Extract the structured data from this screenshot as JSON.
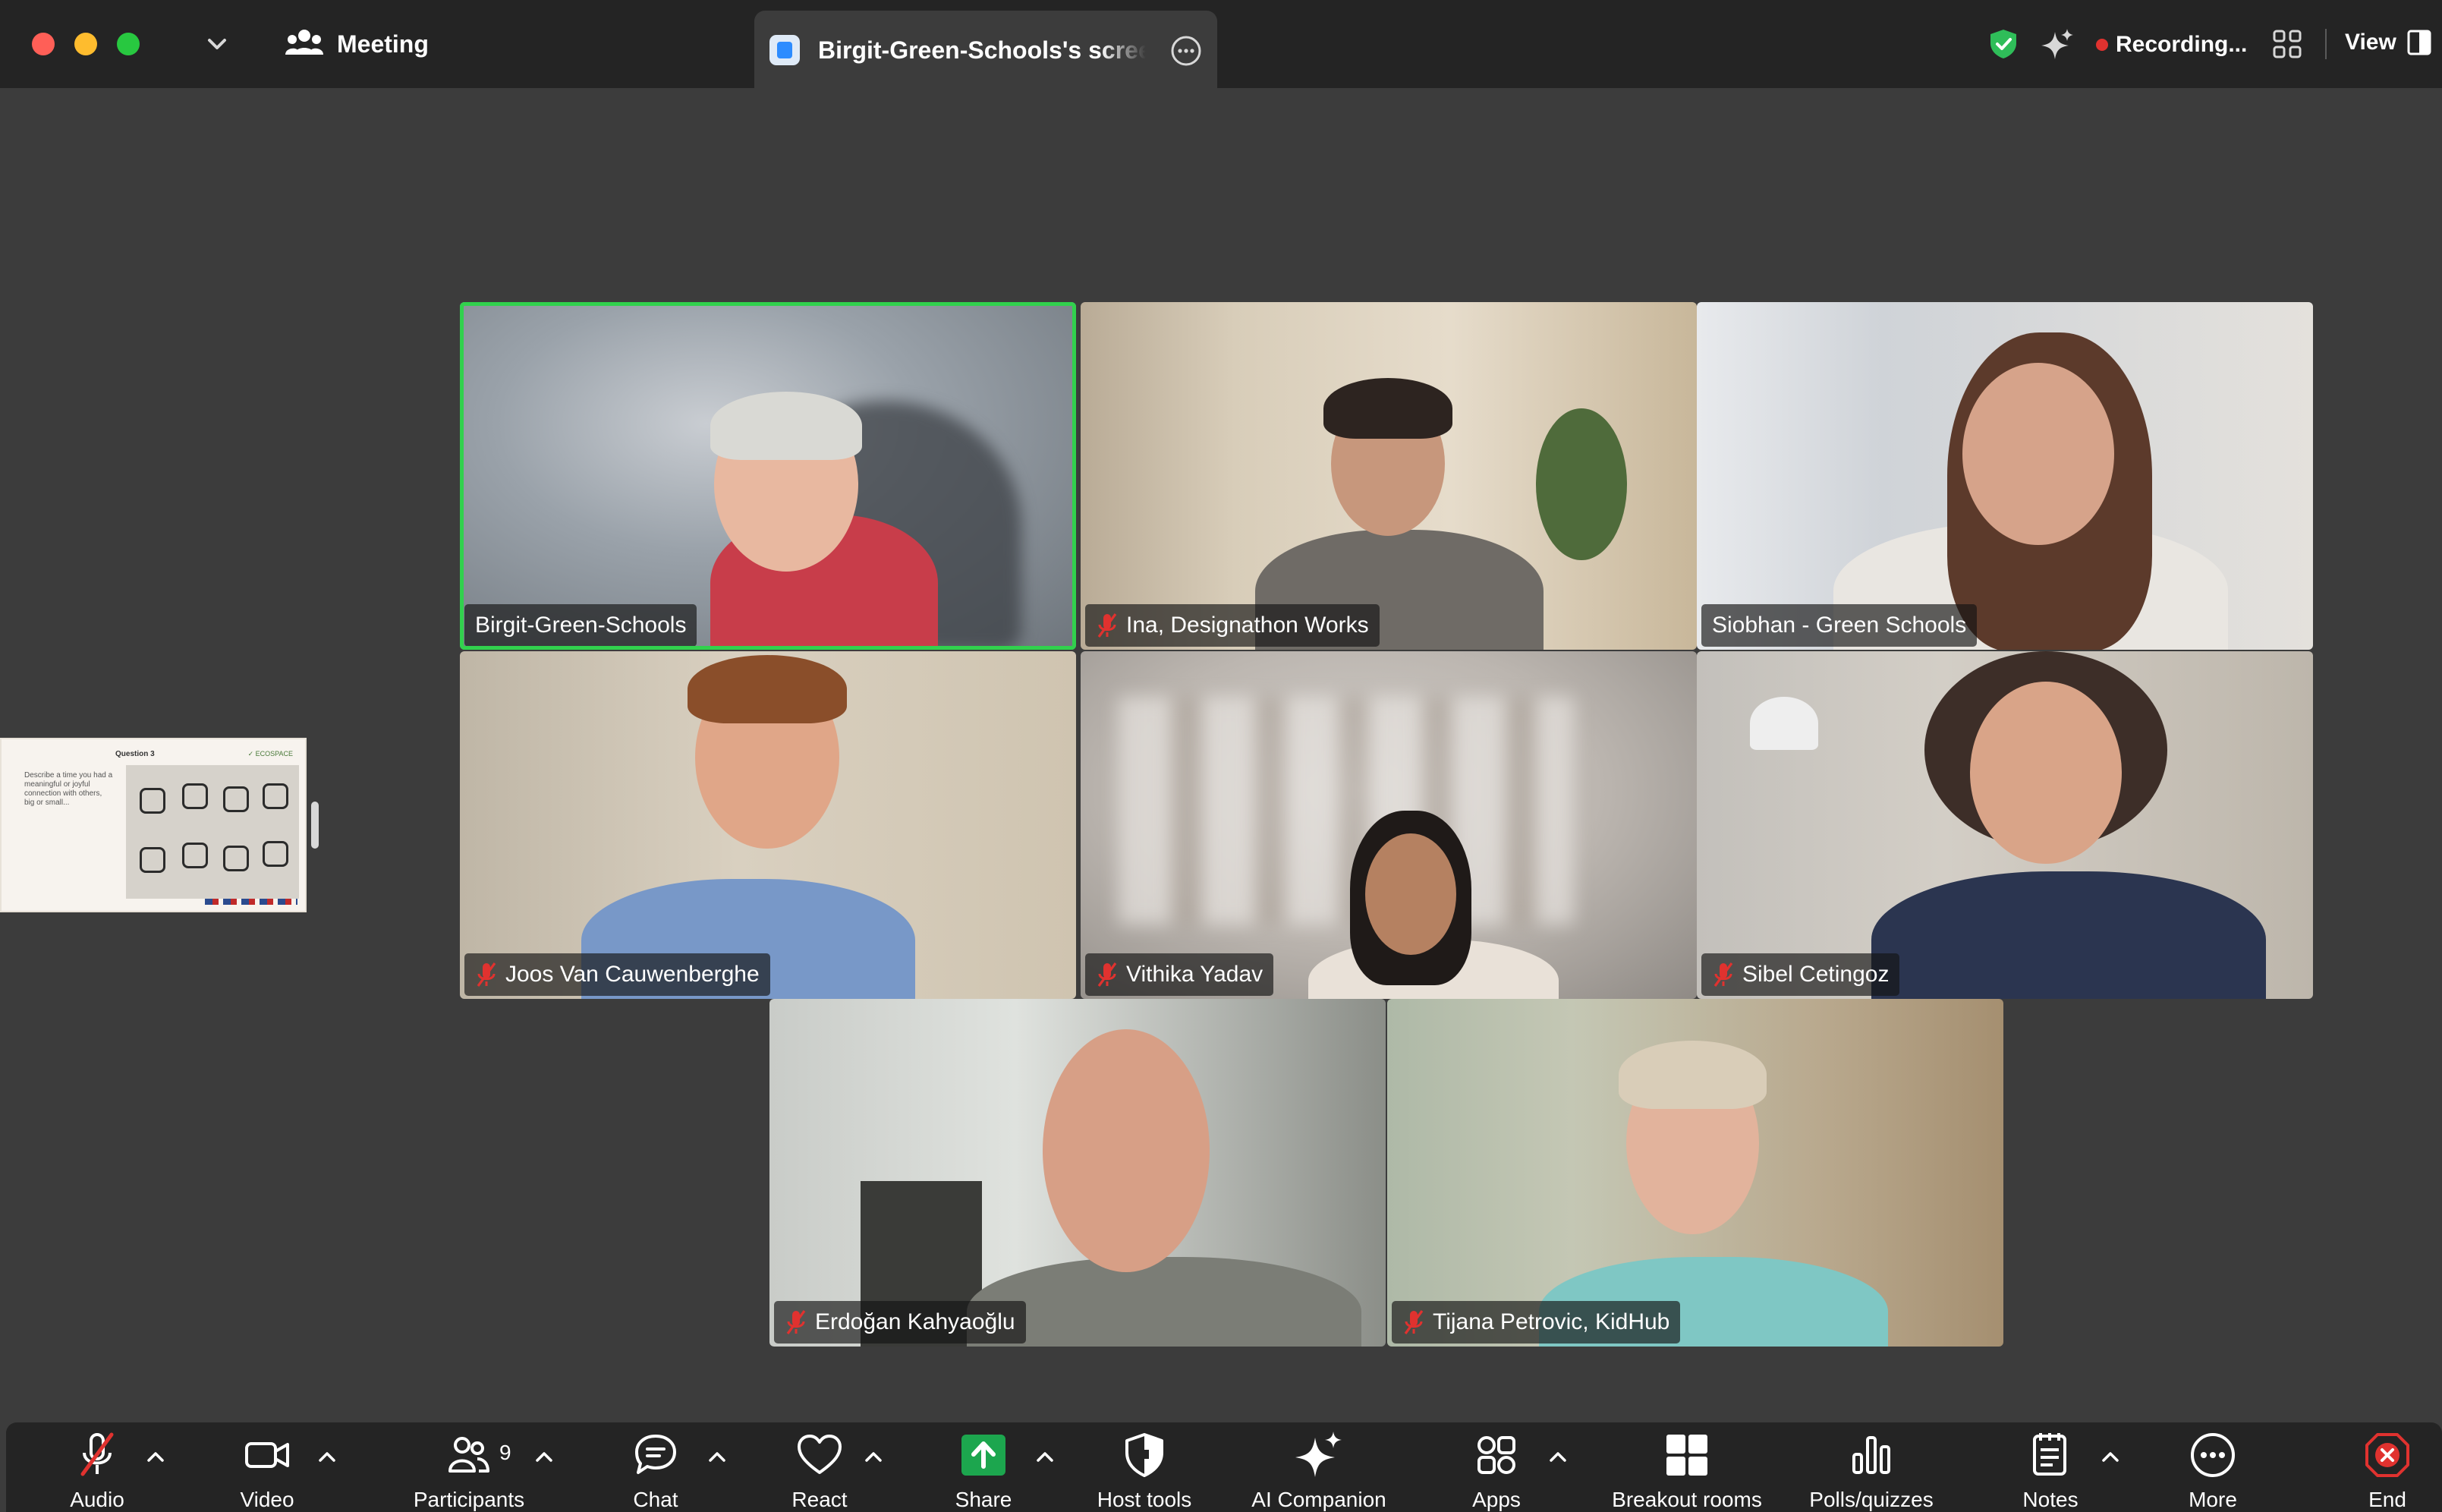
{
  "titlebar": {
    "meeting_label": "Meeting",
    "share_tab_title": "Birgit-Green-Schools's screen share",
    "recording_label": "Recording...",
    "view_label": "View",
    "icons": [
      "close-window",
      "minimize-window",
      "zoom-window",
      "chevron-down",
      "meeting-info",
      "zoom-app",
      "more-options",
      "encryption-shield",
      "ai-sparkle",
      "recording-dot",
      "gallery-grid",
      "view-layout"
    ]
  },
  "shared_screen": {
    "title": "Question 3",
    "logo": "✓ ECOSPACE",
    "body": "Describe a time you had a meaningful or joyful connection with others, big or small..."
  },
  "participants": [
    {
      "name": "Birgit-Green-Schools",
      "muted": false,
      "active_speaker": true
    },
    {
      "name": "Ina, Designathon Works",
      "muted": true,
      "active_speaker": false
    },
    {
      "name": "Siobhan - Green Schools",
      "muted": false,
      "active_speaker": false
    },
    {
      "name": "Joos Van Cauwenberghe",
      "muted": true,
      "active_speaker": false
    },
    {
      "name": "Vithika Yadav",
      "muted": true,
      "active_speaker": false
    },
    {
      "name": "Sibel Cetingoz",
      "muted": true,
      "active_speaker": false
    },
    {
      "name": "Erdoğan Kahyaoğlu",
      "muted": true,
      "active_speaker": false
    },
    {
      "name": "Tijana Petrovic, KidHub",
      "muted": true,
      "active_speaker": false
    }
  ],
  "toolbar": {
    "audio": "Audio",
    "video": "Video",
    "participants": "Participants",
    "participants_count": "9",
    "chat": "Chat",
    "react": "React",
    "share": "Share",
    "host_tools": "Host tools",
    "ai_companion": "AI Companion",
    "apps": "Apps",
    "breakout_rooms": "Breakout rooms",
    "polls": "Polls/quizzes",
    "notes": "Notes",
    "more": "More",
    "end": "End"
  },
  "colors": {
    "active_speaker_border": "#31d14d",
    "share_green": "#1ca64e",
    "end_red": "#e0322f",
    "muted_red": "#e0322f",
    "titlebar_bg": "#242424",
    "canvas_bg": "#3c3c3c"
  }
}
